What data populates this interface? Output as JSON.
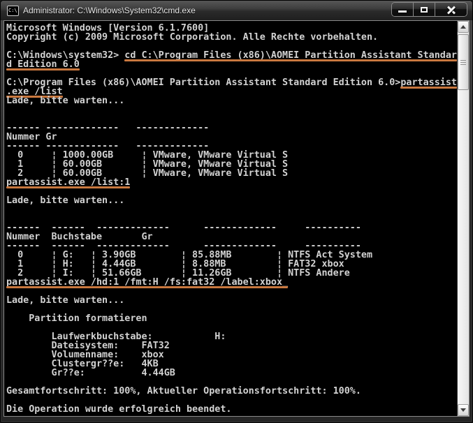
{
  "window": {
    "title": "Administrator: C:\\Windows\\System32\\cmd.exe",
    "icon_text": "C:\\",
    "icons": {
      "app": "cmd-console-icon",
      "minimize": "horizontal-bar",
      "maximize": "square-outline",
      "close": "x-cross",
      "scroll_up": "triangle-up",
      "scroll_down": "triangle-down"
    }
  },
  "colors": {
    "command_underline": "#c9783f",
    "console_text": "#d2d2d2",
    "console_background": "#000000"
  },
  "console": {
    "lines": [
      {
        "text": "Microsoft Windows [Version 6.1.7600]"
      },
      {
        "text": "Copyright (c) 2009 Microsoft Corporation. Alle Rechte vorbehalten."
      },
      {
        "text": ""
      },
      {
        "text": "C:\\Windows\\system32> cd C:\\Program Files (x86)\\AOMEI Partition Assistant Standar",
        "underline": [
          {
            "start": 21,
            "length": 59
          }
        ]
      },
      {
        "text": "d Edition 6.0",
        "underline": [
          {
            "start": 0,
            "length": 13
          }
        ]
      },
      {
        "text": ""
      },
      {
        "text": "C:\\Program Files (x86)\\AOMEI Partition Assistant Standard Edition 6.0>partassist",
        "underline": [
          {
            "start": 70,
            "length": 10
          }
        ]
      },
      {
        "text": ".exe /list",
        "underline": [
          {
            "start": 0,
            "length": 10
          }
        ]
      },
      {
        "text": "Lade, bitte warten..."
      },
      {
        "text": ""
      },
      {
        "text": ""
      },
      {
        "text": "------ -------------   -------------"
      },
      {
        "text": "Nummer Gr"
      },
      {
        "text": "------ -------------   -------------"
      },
      {
        "text": "  0     ¦ 1000.00GB     ¦ VMware, VMware Virtual S"
      },
      {
        "text": "  1     ¦ 60.00GB       ¦ VMware, VMware Virtual S"
      },
      {
        "text": "  2     ¦ 60.00GB       ¦ VMware, VMware Virtual S"
      },
      {
        "text": "partassist.exe /list:1",
        "underline": [
          {
            "start": 0,
            "length": 22
          }
        ]
      },
      {
        "text": ""
      },
      {
        "text": "Lade, bitte warten..."
      },
      {
        "text": ""
      },
      {
        "text": ""
      },
      {
        "text": "------  ------  -------------      -------------     ----------"
      },
      {
        "text": "Nummer  Buchstabe       Gr"
      },
      {
        "text": "------  ------  -------------      -------------     ----------"
      },
      {
        "text": "  0     ¦ G:   ¦ 3.90GB        ¦ 85.88MB        ¦ NTFS Act System"
      },
      {
        "text": "  1     ¦ H:   ¦ 4.44GB        ¦ 8.88MB         ¦ FAT32 xbox"
      },
      {
        "text": "  2     ¦ I:   ¦ 51.66GB       ¦ 11.26GB        ¦ NTFS Andere"
      },
      {
        "text": "partassist.exe /hd:1 /fmt:H /fs:fat32 /label:xbox_",
        "underline": [
          {
            "start": 0,
            "length": 50
          }
        ]
      },
      {
        "text": ""
      },
      {
        "text": "Lade, bitte warten..."
      },
      {
        "text": ""
      },
      {
        "text": "    Partition formatieren"
      },
      {
        "text": ""
      },
      {
        "text": "        Laufwerkbuchstabe:           H:"
      },
      {
        "text": "        Dateisystem:    FAT32"
      },
      {
        "text": "        Volumenname:    xbox"
      },
      {
        "text": "        Clustergr??e:   4KB"
      },
      {
        "text": "        Gr??e:          4.44GB"
      },
      {
        "text": ""
      },
      {
        "text": "Gesamtfortschritt: 100%, Aktueller Operationsfortschritt: 100%."
      },
      {
        "text": ""
      },
      {
        "text": "Die Operation wurde erfolgreich beendet."
      },
      {
        "text": ""
      }
    ]
  }
}
